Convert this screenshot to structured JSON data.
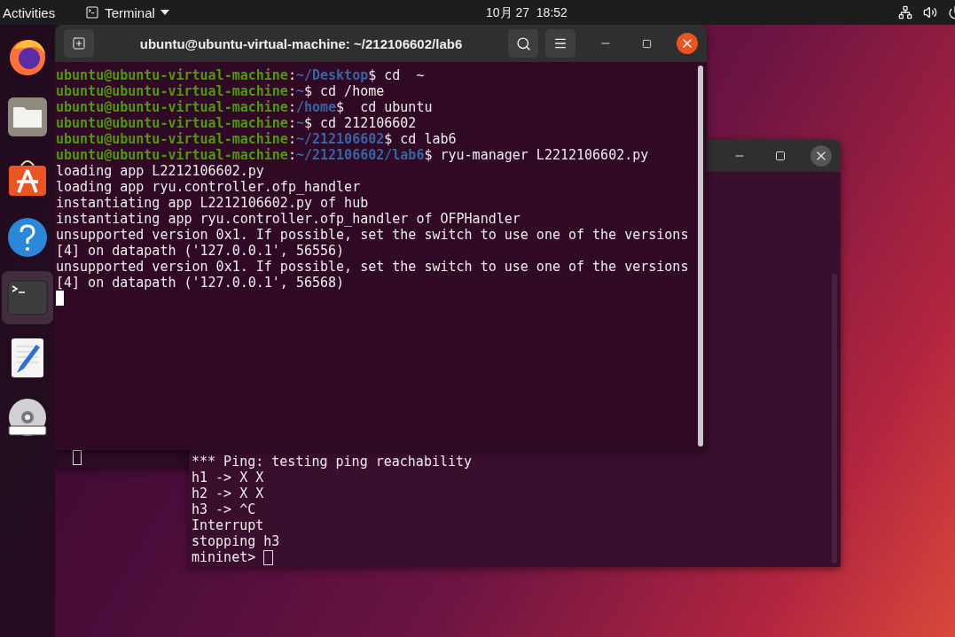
{
  "top_bar": {
    "activities": "Activities",
    "app_menu": "Terminal",
    "clock": "10月 27  18:52"
  },
  "dock": [
    {
      "kind": "firefox",
      "selected": false
    },
    {
      "kind": "files",
      "selected": false
    },
    {
      "kind": "software",
      "selected": false
    },
    {
      "kind": "help",
      "selected": false
    },
    {
      "kind": "terminal",
      "selected": true
    },
    {
      "kind": "editor",
      "selected": false
    },
    {
      "kind": "dvd",
      "selected": false
    }
  ],
  "front_terminal": {
    "title": "ubuntu@ubuntu-virtual-machine: ~/212106602/lab6",
    "lines": [
      [
        {
          "kind": "user",
          "text": "ubuntu@ubuntu-virtual-machine"
        },
        {
          "kind": "plain",
          "text": ":"
        },
        {
          "kind": "path",
          "text": "~/Desktop"
        },
        {
          "kind": "plain",
          "text": "$ cd  ~"
        }
      ],
      [
        {
          "kind": "user",
          "text": "ubuntu@ubuntu-virtual-machine"
        },
        {
          "kind": "plain",
          "text": ":"
        },
        {
          "kind": "path",
          "text": "~"
        },
        {
          "kind": "plain",
          "text": "$ cd /home"
        }
      ],
      [
        {
          "kind": "user",
          "text": "ubuntu@ubuntu-virtual-machine"
        },
        {
          "kind": "plain",
          "text": ":"
        },
        {
          "kind": "path",
          "text": "/home"
        },
        {
          "kind": "plain",
          "text": "$  cd ubuntu"
        }
      ],
      [
        {
          "kind": "user",
          "text": "ubuntu@ubuntu-virtual-machine"
        },
        {
          "kind": "plain",
          "text": ":"
        },
        {
          "kind": "path",
          "text": "~"
        },
        {
          "kind": "plain",
          "text": "$ cd 212106602"
        }
      ],
      [
        {
          "kind": "user",
          "text": "ubuntu@ubuntu-virtual-machine"
        },
        {
          "kind": "plain",
          "text": ":"
        },
        {
          "kind": "path",
          "text": "~/212106602"
        },
        {
          "kind": "plain",
          "text": "$ cd lab6"
        }
      ],
      [
        {
          "kind": "user",
          "text": "ubuntu@ubuntu-virtual-machine"
        },
        {
          "kind": "plain",
          "text": ":"
        },
        {
          "kind": "path",
          "text": "~/212106602/lab6"
        },
        {
          "kind": "plain",
          "text": "$ ryu-manager L2212106602.py"
        }
      ],
      [
        {
          "kind": "plain",
          "text": "loading app L2212106602.py"
        }
      ],
      [
        {
          "kind": "plain",
          "text": "loading app ryu.controller.ofp_handler"
        }
      ],
      [
        {
          "kind": "plain",
          "text": "instantiating app L2212106602.py of hub"
        }
      ],
      [
        {
          "kind": "plain",
          "text": "instantiating app ryu.controller.ofp_handler of OFPHandler"
        }
      ],
      [
        {
          "kind": "plain",
          "text": "unsupported version 0x1. If possible, set the switch to use one of the versions"
        }
      ],
      [
        {
          "kind": "plain",
          "text": "[4] on datapath ('127.0.0.1', 56556)"
        }
      ],
      [
        {
          "kind": "plain",
          "text": "unsupported version 0x1. If possible, set the switch to use one of the versions"
        }
      ],
      [
        {
          "kind": "plain",
          "text": "[4] on datapath ('127.0.0.1', 56568)"
        }
      ]
    ]
  },
  "back_terminal": {
    "lines": [
      [
        {
          "kind": "plain",
          "text": "*** Ping: testing ping reachability"
        }
      ],
      [
        {
          "kind": "plain",
          "text": "h1 -> X X"
        }
      ],
      [
        {
          "kind": "plain",
          "text": "h2 -> X X"
        }
      ],
      [
        {
          "kind": "plain",
          "text": "h3 -> ^C"
        }
      ],
      [
        {
          "kind": "plain",
          "text": "Interrupt"
        }
      ],
      [
        {
          "kind": "plain",
          "text": "stopping h3"
        }
      ],
      [
        {
          "kind": "plain",
          "text": "mininet> "
        }
      ]
    ]
  }
}
